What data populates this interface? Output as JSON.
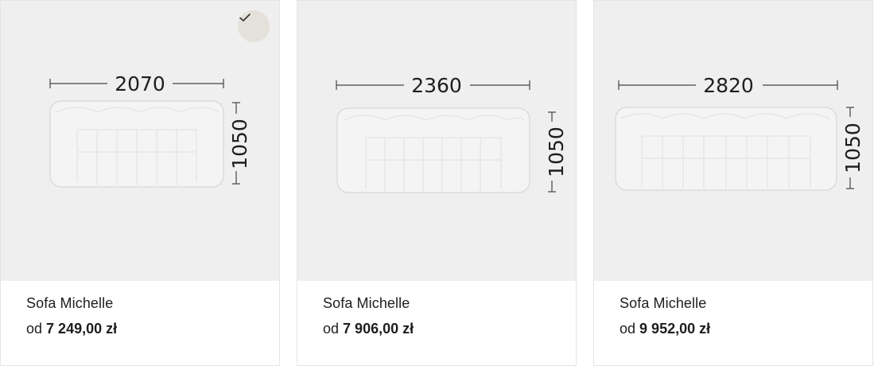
{
  "products": [
    {
      "name": "Sofa Michelle",
      "price_prefix": "od",
      "price": "7 249,00 zł",
      "width_mm": "2070",
      "depth_mm": "1050",
      "selected": true,
      "selected_icon": "checkmark-icon"
    },
    {
      "name": "Sofa Michelle",
      "price_prefix": "od",
      "price": "7 906,00 zł",
      "width_mm": "2360",
      "depth_mm": "1050",
      "selected": false
    },
    {
      "name": "Sofa Michelle",
      "price_prefix": "od",
      "price": "9 952,00 zł",
      "width_mm": "2820",
      "depth_mm": "1050",
      "selected": false
    }
  ],
  "colors": {
    "image_background": "#efefef",
    "selected_badge": "#e4e0da",
    "text": "#1e1e1e"
  }
}
